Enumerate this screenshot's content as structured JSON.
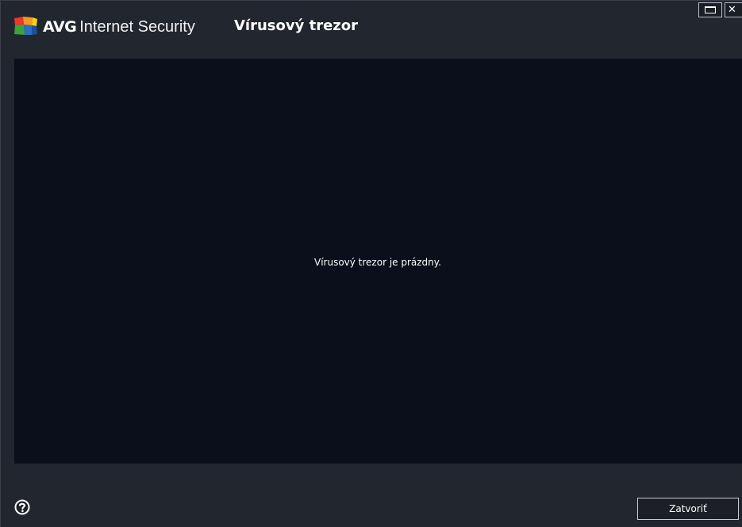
{
  "titlebar": {
    "brand_name": "AVG",
    "product_name": "Internet Security",
    "window_title": "Vírusový trezor",
    "logo_icon": "avg-logo-icon",
    "maximize_icon": "maximize-icon",
    "close_icon": "close-icon",
    "close_glyph": "✕"
  },
  "content": {
    "empty_message": "Vírusový trezor je prázdny."
  },
  "footer": {
    "help_icon": "help-icon",
    "close_button_label": "Zatvoriť"
  },
  "colors": {
    "window_background": "#22262f",
    "content_background": "#0b0f1b",
    "logo_red": "#e8392a",
    "logo_orange": "#f59a1f",
    "logo_yellow": "#f6d11d",
    "logo_green": "#3ca33b",
    "logo_blue": "#2c6fc0"
  }
}
